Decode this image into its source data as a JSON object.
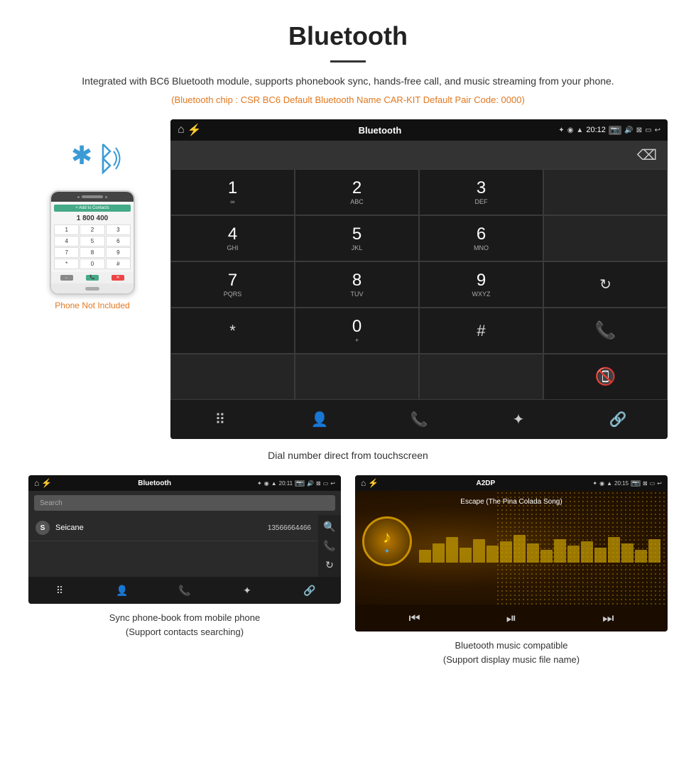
{
  "page": {
    "title": "Bluetooth",
    "subtitle": "Integrated with BC6 Bluetooth module, supports phonebook sync, hands-free call, and music streaming from your phone.",
    "specs": "(Bluetooth chip : CSR BC6    Default Bluetooth Name CAR-KIT    Default Pair Code: 0000)",
    "caption_main": "Dial number direct from touchscreen",
    "phone_not_included": "Phone Not Included"
  },
  "dialer": {
    "screen_title": "Bluetooth",
    "time": "20:12",
    "keys": [
      {
        "number": "1",
        "letters": ""
      },
      {
        "number": "2",
        "letters": "ABC"
      },
      {
        "number": "3",
        "letters": "DEF"
      },
      {
        "number": "4",
        "letters": "GHI"
      },
      {
        "number": "5",
        "letters": "JKL"
      },
      {
        "number": "6",
        "letters": "MNO"
      },
      {
        "number": "7",
        "letters": "PQRS"
      },
      {
        "number": "8",
        "letters": "TUV"
      },
      {
        "number": "9",
        "letters": "WXYZ"
      }
    ],
    "star": "*",
    "zero": "0+",
    "hash": "#"
  },
  "phonebook": {
    "status_title": "Bluetooth",
    "time": "20:11",
    "search_placeholder": "Search",
    "contact_name": "Seicane",
    "contact_phone": "13566664466",
    "caption": "Sync phone-book from mobile phone\n(Support contacts searching)"
  },
  "music": {
    "status_title": "A2DP",
    "time": "20:15",
    "song_title": "Escape (The Pina Colada Song)",
    "caption": "Bluetooth music compatible\n(Support display music file name)",
    "eq_bars": [
      30,
      45,
      60,
      35,
      55,
      40,
      50,
      65,
      45,
      30,
      55,
      40,
      50,
      35,
      60,
      45,
      30,
      55
    ]
  }
}
